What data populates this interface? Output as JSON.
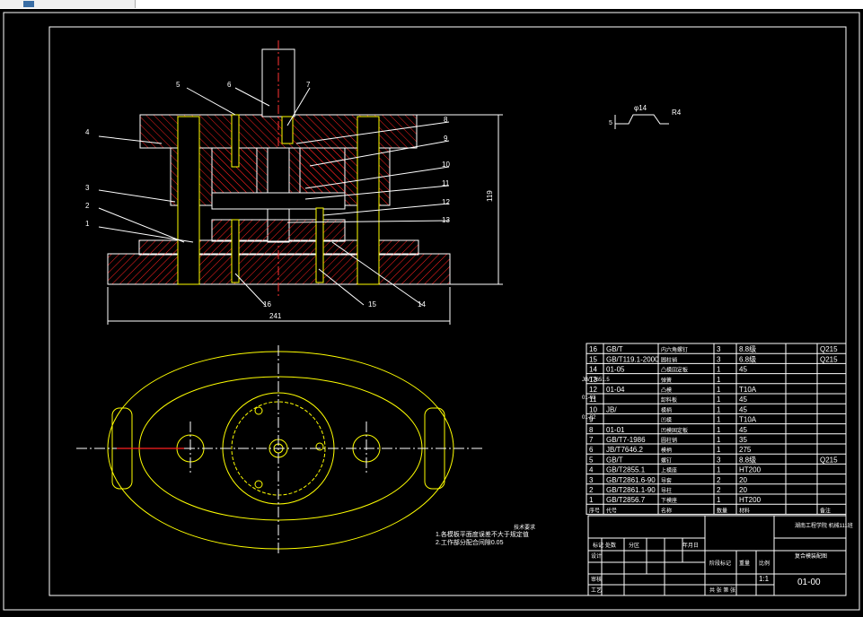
{
  "app": {
    "tab_label": ""
  },
  "colors": {
    "background": "#000000",
    "frame": "#ffffff",
    "outline": "#ffff00",
    "hatch": "#ff0000",
    "centerline": "#ff3333",
    "text": "#ffffff"
  },
  "drawing": {
    "balloons": [
      "1",
      "2",
      "3",
      "4",
      "5",
      "6",
      "7",
      "8",
      "9",
      "10",
      "11",
      "12",
      "13",
      "14",
      "15",
      "16"
    ],
    "dims": {
      "width": "241",
      "height": "119",
      "diameter": "φ14",
      "radius": "R4",
      "step": "5"
    },
    "notes_title": "技术要求",
    "notes": [
      "1.各模板平面度误差不大于规定值",
      "2.工作部分配合间隙0.05"
    ]
  },
  "bom": {
    "rows": [
      {
        "no": "16",
        "code": "GB/T",
        "name": "内六角螺钉",
        "qty": "3",
        "mat": "8.8级",
        "note": "Q215"
      },
      {
        "no": "15",
        "code": "GB/T119.1-2000",
        "name": "圆柱销",
        "qty": "3",
        "mat": "6.8级",
        "note": "Q215"
      },
      {
        "no": "14",
        "code": "01-05",
        "name": "凸模固定板",
        "qty": "1",
        "mat": "45",
        "note": ""
      },
      {
        "no": "13",
        "code": "",
        "name": "弹簧",
        "qty": "1",
        "mat": "",
        "note": ""
      },
      {
        "no": "12",
        "code": "01-04",
        "name": "凸模",
        "qty": "1",
        "mat": "T10A",
        "note": ""
      },
      {
        "no": "11",
        "code": "",
        "name": "卸料板",
        "qty": "1",
        "mat": "45",
        "note": ""
      },
      {
        "no": "10",
        "code": "JB/",
        "name": "模柄",
        "qty": "1",
        "mat": "45",
        "note": ""
      },
      {
        "no": "9",
        "code": "",
        "name": "凹模",
        "qty": "1",
        "mat": "T10A",
        "note": ""
      },
      {
        "no": "8",
        "code": "01-01",
        "name": "凹模固定板",
        "qty": "1",
        "mat": "45",
        "note": ""
      },
      {
        "no": "7",
        "code": "GB/T7-1986",
        "name": "圆柱销",
        "qty": "1",
        "mat": "35",
        "note": ""
      },
      {
        "no": "6",
        "code": "JB/T7646.2",
        "name": "模柄",
        "qty": "1",
        "mat": "275",
        "note": ""
      },
      {
        "no": "5",
        "code": "GB/T",
        "name": "螺钉",
        "qty": "3",
        "mat": "8.8级",
        "note": "Q215"
      },
      {
        "no": "4",
        "code": "GB/T2855.1",
        "name": "上模座",
        "qty": "1",
        "mat": "HT200",
        "note": ""
      },
      {
        "no": "3",
        "code": "GB/T2861.6-90",
        "name": "导套",
        "qty": "2",
        "mat": "20",
        "note": ""
      },
      {
        "no": "2",
        "code": "GB/T2861.1-90",
        "name": "导柱",
        "qty": "2",
        "mat": "20",
        "note": ""
      },
      {
        "no": "1",
        "code": "GB/T2856.7",
        "name": "下模座",
        "qty": "1",
        "mat": "HT200",
        "note": ""
      }
    ],
    "side_codes": [
      "JB/T7651.5",
      "01-03",
      "01-02"
    ],
    "header": {
      "no": "序号",
      "code": "代号",
      "name": "名称",
      "qty": "数量",
      "mat": "材料",
      "note": "备注"
    }
  },
  "title_block": {
    "school": "湖南工程学院\n机械111班",
    "drawing_name": "复合模装配图",
    "scale": "1:1",
    "drawing_no": "01-00",
    "weight_label": "重量",
    "scale_label": "比例",
    "sheet": "共  张  第  张",
    "rows_labels": [
      "标记",
      "处数",
      "分区",
      "更改文件号",
      "签名",
      "年月日"
    ],
    "design": "设计",
    "check": "审核",
    "process": "工艺",
    "approve": "批准",
    "stage": "阶段标记"
  }
}
